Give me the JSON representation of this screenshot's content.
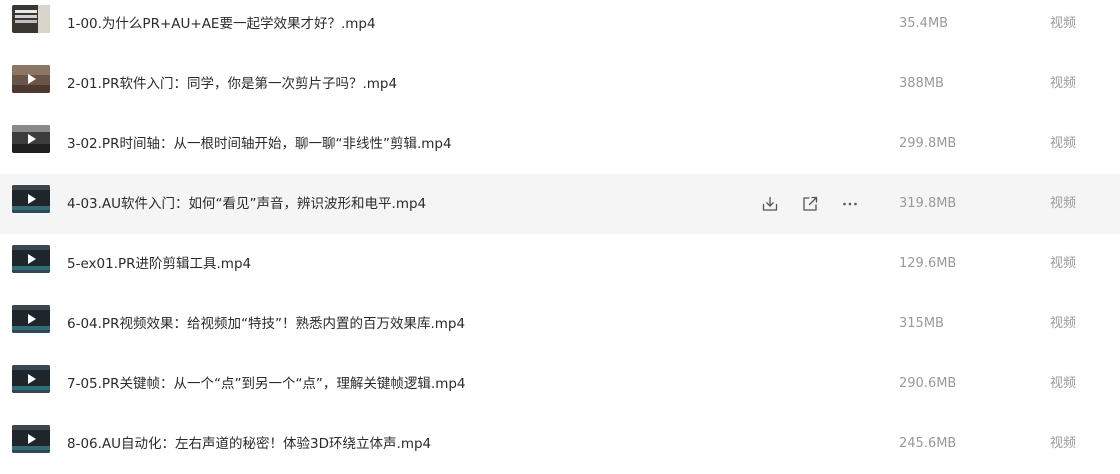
{
  "files": [
    {
      "name": "1-00.为什么PR+AU+AE要一起学效果才好？.mp4",
      "size": "35.4MB",
      "type": "视频",
      "thumb": "text"
    },
    {
      "name": "2-01.PR软件入门：同学，你是第一次剪片子吗？.mp4",
      "size": "388MB",
      "type": "视频",
      "thumb": "warm"
    },
    {
      "name": "3-02.PR时间轴：从一根时间轴开始，聊一聊“非线性”剪辑.mp4",
      "size": "299.8MB",
      "type": "视频",
      "thumb": "dark"
    },
    {
      "name": "4-03.AU软件入门：如何“看见”声音，辨识波形和电平.mp4",
      "size": "319.8MB",
      "type": "视频",
      "thumb": "app",
      "hovered": true
    },
    {
      "name": "5-ex01.PR进阶剪辑工具.mp4",
      "size": "129.6MB",
      "type": "视频",
      "thumb": "app"
    },
    {
      "name": "6-04.PR视频效果：给视频加“特技”！熟悉内置的百万效果库.mp4",
      "size": "315MB",
      "type": "视频",
      "thumb": "app"
    },
    {
      "name": "7-05.PR关键帧：从一个“点”到另一个“点”，理解关键帧逻辑.mp4",
      "size": "290.6MB",
      "type": "视频",
      "thumb": "app"
    },
    {
      "name": "8-06.AU自动化：左右声道的秘密！体验3D环绕立体声.mp4",
      "size": "245.6MB",
      "type": "视频",
      "thumb": "app"
    }
  ],
  "row_actions": [
    {
      "icon": "download-icon"
    },
    {
      "icon": "share-icon"
    },
    {
      "icon": "more-icon"
    }
  ],
  "colors": {
    "text": "#2b2b2b",
    "muted": "#9a9a9a",
    "hover_bg": "#f5f5f6"
  }
}
